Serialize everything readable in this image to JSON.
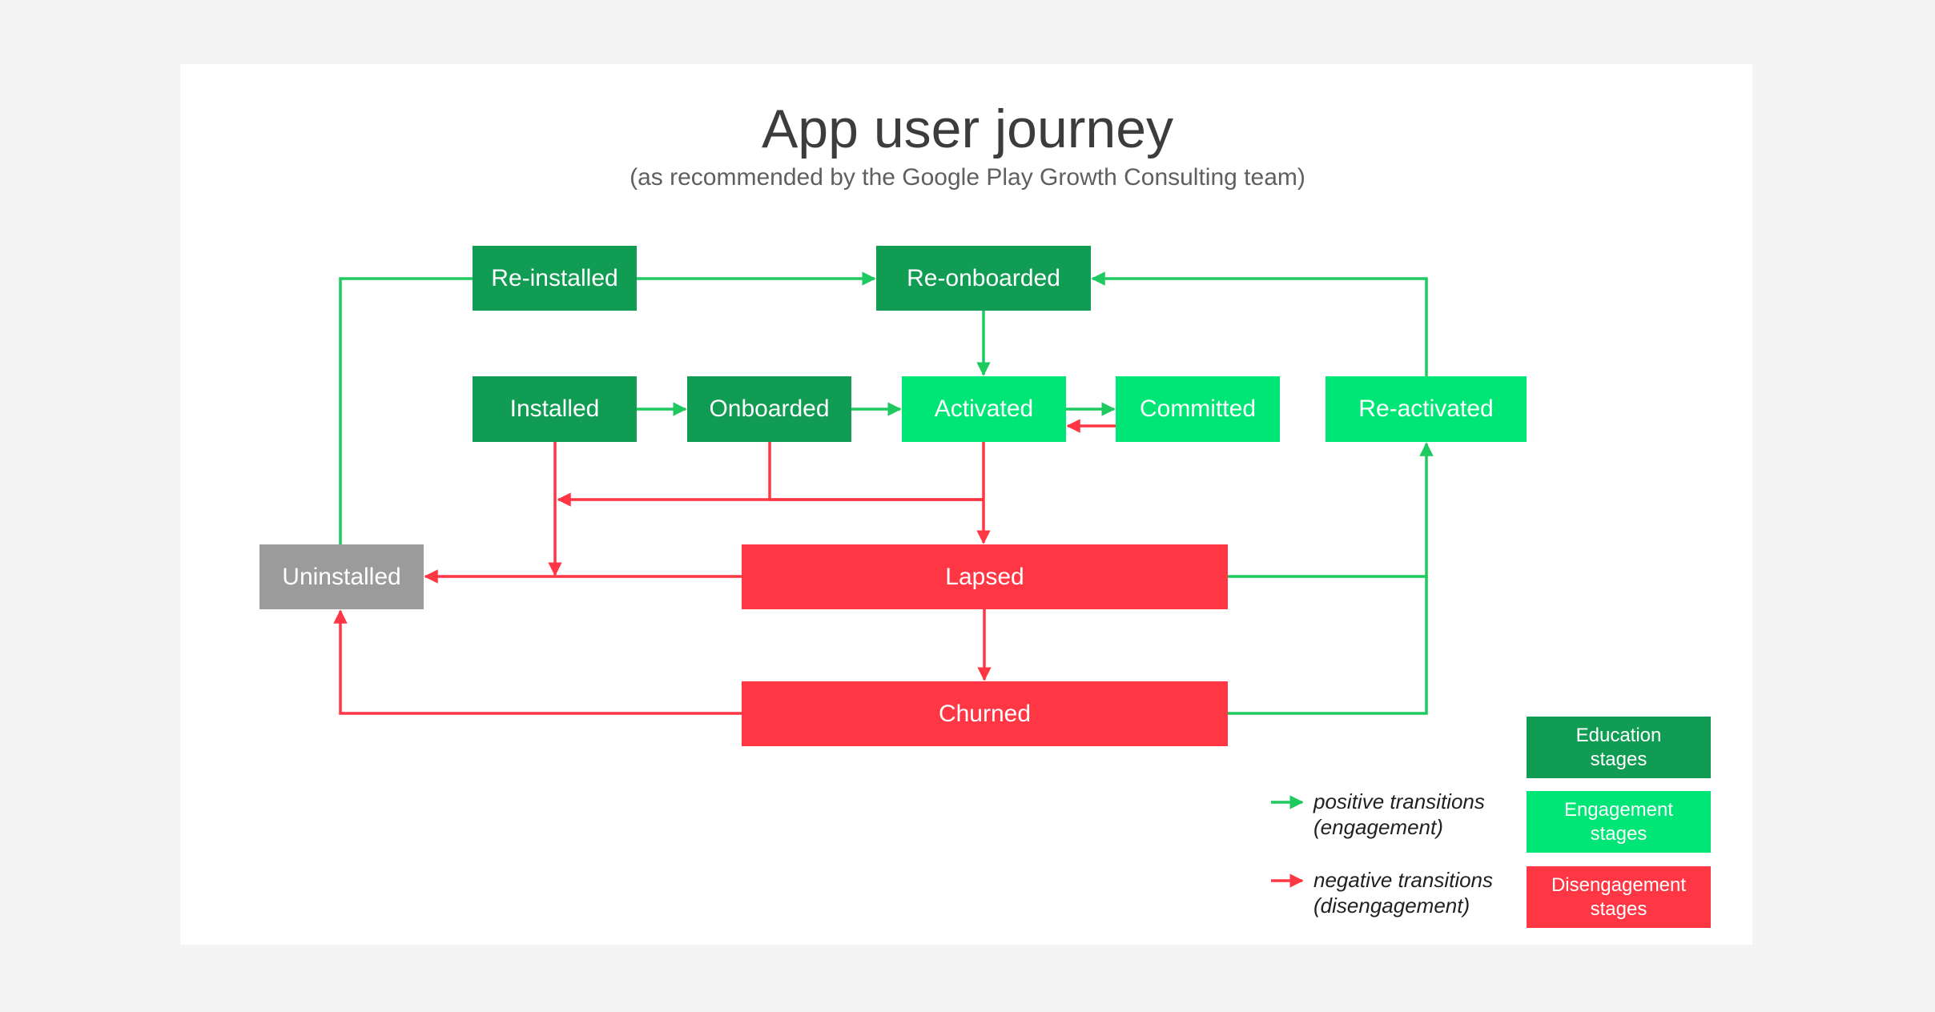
{
  "title": "App user journey",
  "subtitle": "(as recommended by the Google Play Growth Consulting team)",
  "colors": {
    "education": "#119c53",
    "engagement": "#00e676",
    "disengagement": "#ff3643",
    "neutral": "#9b9b9b",
    "positive_arrow": "#1ec95f",
    "negative_arrow": "#ff3643"
  },
  "nodes": {
    "reinstalled": {
      "label": "Re-installed",
      "category": "education"
    },
    "reonboarded": {
      "label": "Re-onboarded",
      "category": "education"
    },
    "installed": {
      "label": "Installed",
      "category": "education"
    },
    "onboarded": {
      "label": "Onboarded",
      "category": "education"
    },
    "activated": {
      "label": "Activated",
      "category": "engagement"
    },
    "committed": {
      "label": "Committed",
      "category": "engagement"
    },
    "reactivated": {
      "label": "Re-activated",
      "category": "engagement"
    },
    "uninstalled": {
      "label": "Uninstalled",
      "category": "neutral"
    },
    "lapsed": {
      "label": "Lapsed",
      "category": "disengagement"
    },
    "churned": {
      "label": "Churned",
      "category": "disengagement"
    }
  },
  "edges": [
    {
      "from": "uninstalled",
      "to": "reinstalled",
      "type": "positive"
    },
    {
      "from": "reinstalled",
      "to": "reonboarded",
      "type": "positive"
    },
    {
      "from": "reactivated",
      "to": "reonboarded",
      "type": "positive"
    },
    {
      "from": "reonboarded",
      "to": "activated",
      "type": "positive"
    },
    {
      "from": "installed",
      "to": "onboarded",
      "type": "positive"
    },
    {
      "from": "onboarded",
      "to": "activated",
      "type": "positive"
    },
    {
      "from": "activated",
      "to": "committed",
      "type": "positive"
    },
    {
      "from": "committed",
      "to": "activated",
      "type": "negative"
    },
    {
      "from": "installed",
      "to": "uninstalled",
      "type": "negative"
    },
    {
      "from": "onboarded",
      "to": "uninstalled",
      "type": "negative"
    },
    {
      "from": "activated",
      "to": "lapsed",
      "type": "negative"
    },
    {
      "from": "lapsed",
      "to": "uninstalled",
      "type": "negative"
    },
    {
      "from": "lapsed",
      "to": "churned",
      "type": "negative"
    },
    {
      "from": "churned",
      "to": "uninstalled",
      "type": "negative"
    },
    {
      "from": "lapsed",
      "to": "reactivated",
      "type": "positive"
    },
    {
      "from": "churned",
      "to": "reactivated",
      "type": "positive"
    }
  ],
  "legend": {
    "positive": "positive transitions\n(engagement)",
    "negative": "negative transitions\n(disengagement)",
    "education": "Education\nstages",
    "engagement": "Engagement\nstages",
    "disengagement": "Disengagement\nstages"
  }
}
